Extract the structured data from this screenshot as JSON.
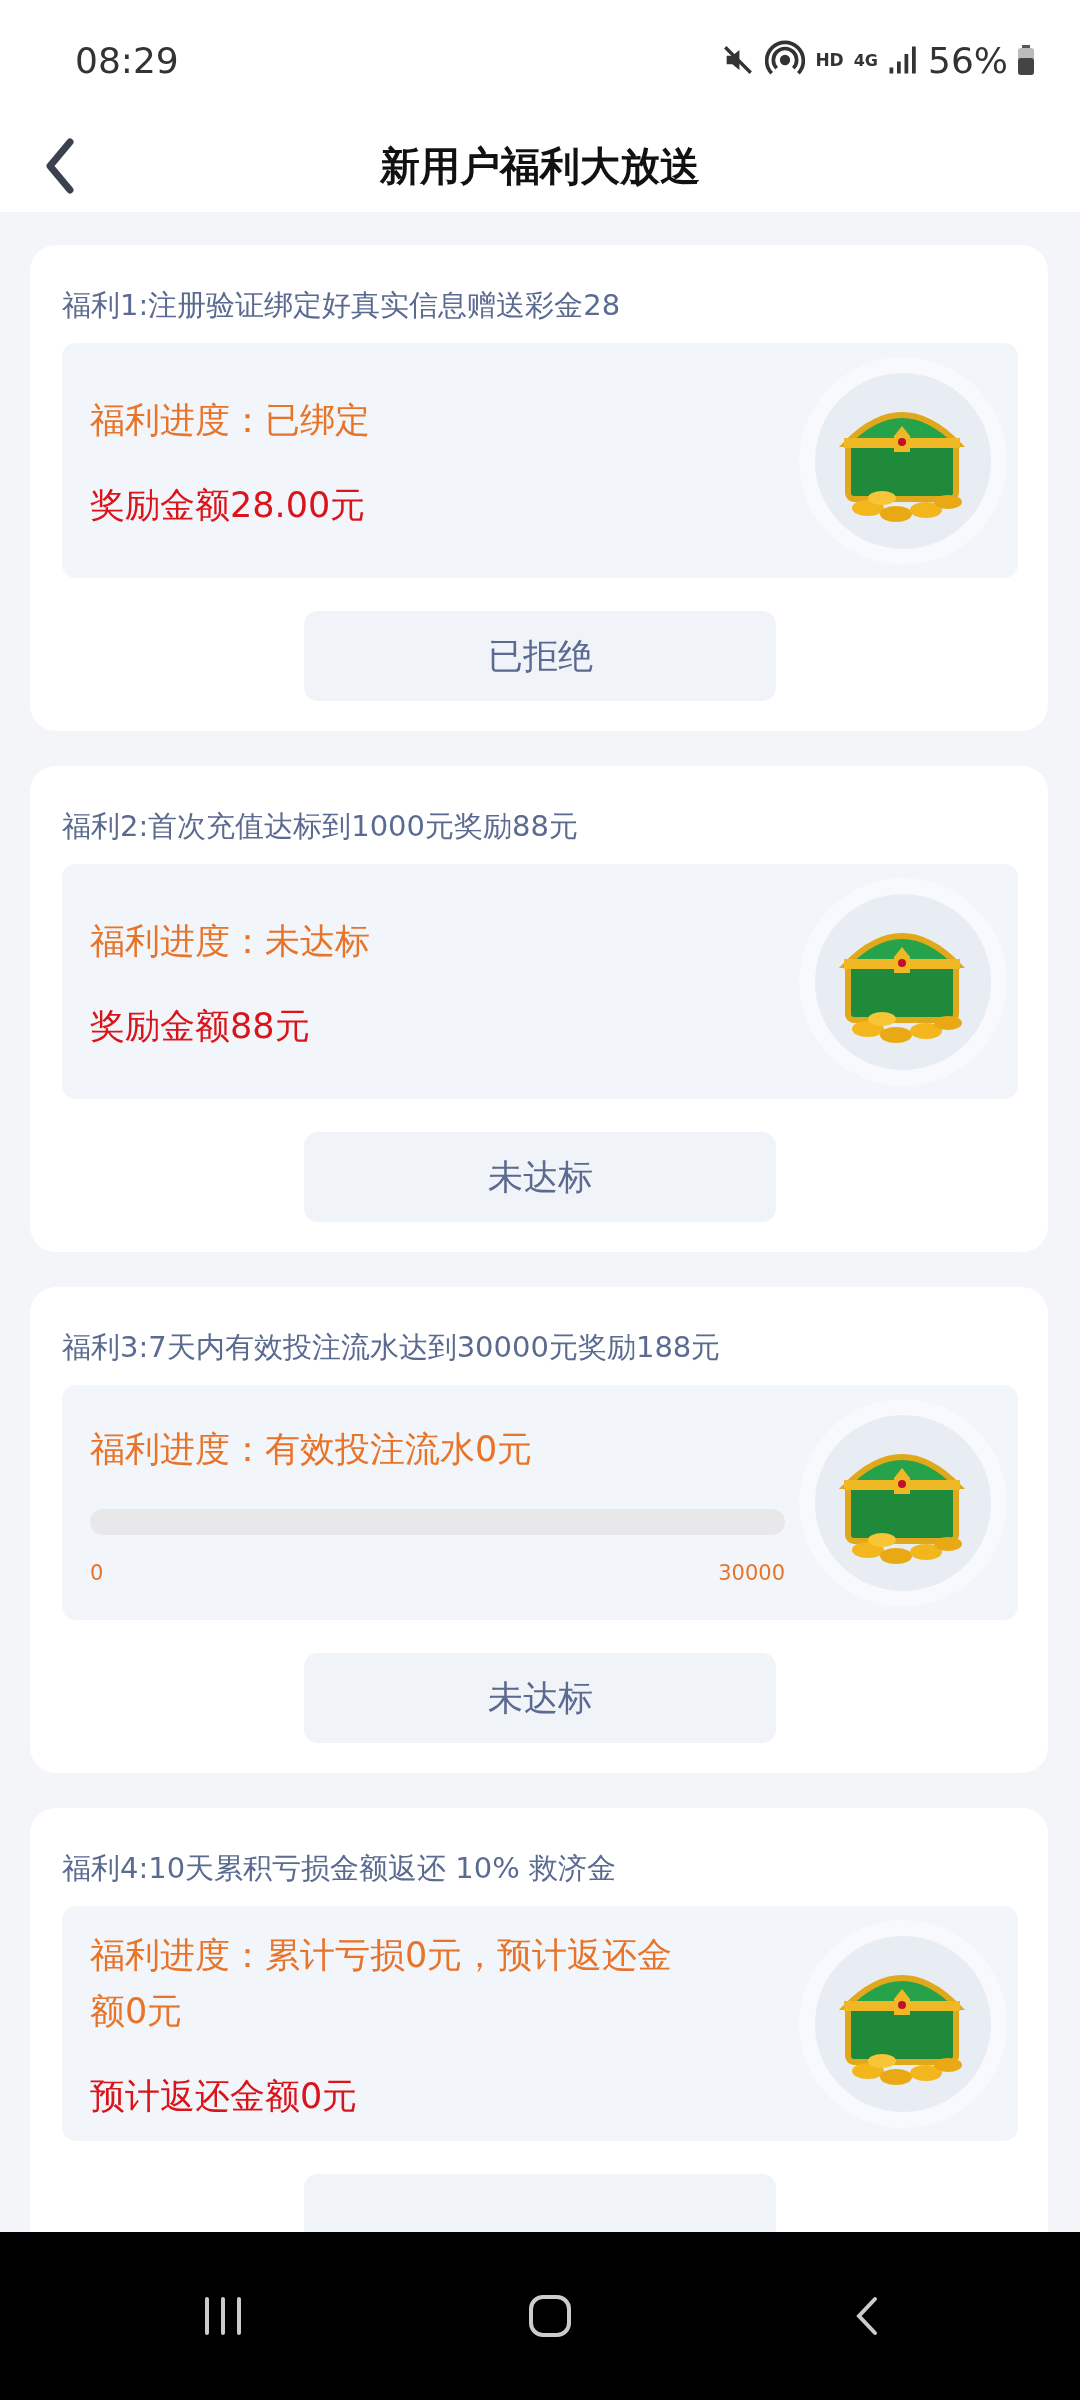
{
  "status_bar": {
    "time": "08:29",
    "network_label": "HD",
    "network_type": "4G",
    "battery": "56%"
  },
  "header": {
    "title": "新用户福利大放送"
  },
  "cards": [
    {
      "title": "福利1:注册验证绑定好真实信息赠送彩金28",
      "lines": [
        {
          "kind": "status",
          "text": "福利进度：已绑定"
        },
        {
          "kind": "amount",
          "text": "奖励金额28.00元"
        }
      ],
      "button": "已拒绝"
    },
    {
      "title": "福利2:首次充值达标到1000元奖励88元",
      "lines": [
        {
          "kind": "status",
          "text": "福利进度：未达标"
        },
        {
          "kind": "amount",
          "text": "奖励金额88元"
        }
      ],
      "button": "未达标"
    },
    {
      "title": "福利3:7天内有效投注流水达到30000元奖励188元",
      "lines": [
        {
          "kind": "status",
          "text": "福利进度：有效投注流水0元"
        },
        {
          "kind": "progress",
          "level": 0,
          "min_label": "0",
          "max_label": "30000"
        }
      ],
      "button": "未达标"
    },
    {
      "title": "福利4:10天累积亏损金额返还 10% 救济金",
      "lines": [
        {
          "kind": "status",
          "text": "福利进度：累计亏损0元，预计返还金额0元"
        },
        {
          "kind": "amount",
          "text": "预计返还金额0元"
        }
      ]
    }
  ]
}
